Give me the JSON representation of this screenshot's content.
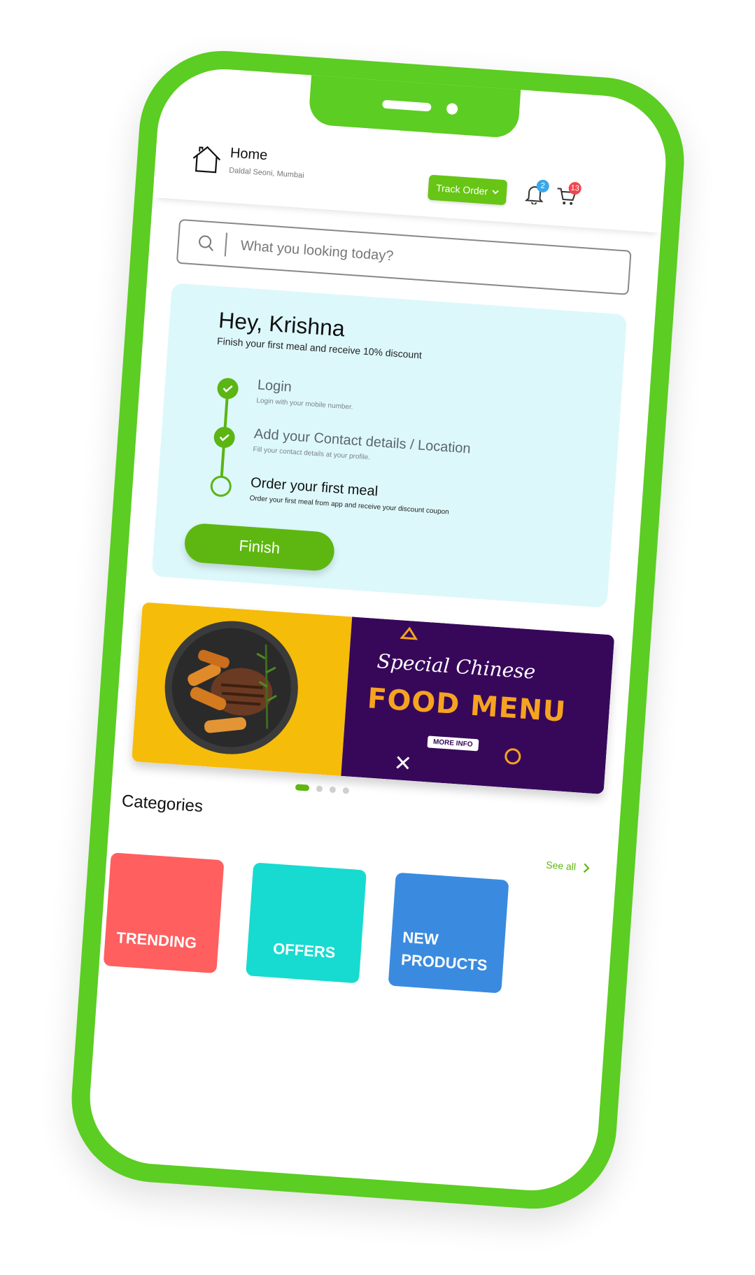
{
  "header": {
    "title": "Home",
    "location": "Daldal Seoni, Mumbai",
    "track_order_label": "Track Order",
    "notification_count": "2",
    "cart_count": "13"
  },
  "search": {
    "placeholder": "What you looking today?"
  },
  "onboarding": {
    "greeting": "Hey, Krishna",
    "subtitle": "Finish your first meal and receive 10% discount",
    "steps": [
      {
        "title": "Login",
        "subtitle": "Login with your mobile number.",
        "done": true
      },
      {
        "title": "Add your Contact details / Location",
        "subtitle": "Fill your contact details at your profile.",
        "done": true
      },
      {
        "title": "Order your first meal",
        "subtitle": "Order your first meal from app and receive your discount coupon",
        "done": false
      }
    ],
    "finish_label": "Finish"
  },
  "banner": {
    "script_text": "Special Chinese",
    "headline": "FOOD MENU",
    "more_info_label": "MORE INFO",
    "slide_count": 4,
    "active_slide": 1
  },
  "categories": {
    "title": "Categories",
    "see_all_label": "See all",
    "items": [
      {
        "label": "TRENDING",
        "color": "#ff5f5f"
      },
      {
        "label": "OFFERS",
        "color": "#17dbd0"
      },
      {
        "label": "NEW PRODUCTS",
        "color": "#3a8be0"
      }
    ]
  },
  "colors": {
    "brand_green": "#5ccd22",
    "accent_green": "#5eb711",
    "card_bg": "#ddf8fb",
    "banner_yellow": "#f6bc0a",
    "banner_purple": "#37085a"
  }
}
